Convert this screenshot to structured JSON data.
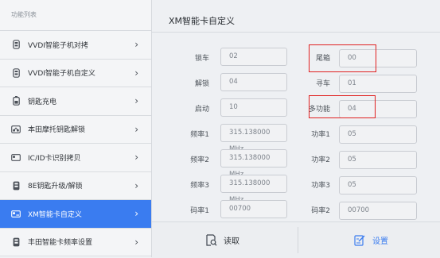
{
  "sidebar": {
    "title": "功能列表",
    "items": [
      {
        "label": "VVDI智能子机对拷",
        "icon": "remote-key-icon"
      },
      {
        "label": "VVDI智能子机自定义",
        "icon": "remote-key-icon"
      },
      {
        "label": "钥匙充电",
        "icon": "battery-key-icon"
      },
      {
        "label": "本田摩托钥匙解锁",
        "icon": "motorcycle-icon"
      },
      {
        "label": "IC/ID卡识别拷贝",
        "icon": "card-icon"
      },
      {
        "label": "8E钥匙升级/解锁",
        "icon": "key-fob-icon"
      },
      {
        "label": "XM智能卡自定义",
        "icon": "smart-card-icon",
        "active": true
      },
      {
        "label": "丰田智能卡频率设置",
        "icon": "key-fob-icon"
      }
    ]
  },
  "main": {
    "title": "XM智能卡自定义",
    "fields": {
      "lock": {
        "label": "锁车",
        "value": "02"
      },
      "unlock": {
        "label": "解锁",
        "value": "04"
      },
      "start": {
        "label": "启动",
        "value": "10"
      },
      "freq1": {
        "label": "频率1",
        "value": "315.138000   MHz"
      },
      "freq2": {
        "label": "频率2",
        "value": "315.138000   MHz"
      },
      "freq3": {
        "label": "频率3",
        "value": "315.138000   MHz"
      },
      "code1": {
        "label": "码率1",
        "value": "00700"
      },
      "trunk": {
        "label": "尾箱",
        "value": "00"
      },
      "find": {
        "label": "寻车",
        "value": "01"
      },
      "multi": {
        "label": "多功能",
        "value": "04"
      },
      "power1": {
        "label": "功率1",
        "value": "05"
      },
      "power2": {
        "label": "功率2",
        "value": "05"
      },
      "power3": {
        "label": "功率3",
        "value": "05"
      },
      "code2": {
        "label": "码率2",
        "value": "00700"
      }
    },
    "read_label": "读取",
    "set_label": "设置"
  },
  "colors": {
    "accent": "#3a7cf0",
    "highlight_box": "#e02020",
    "sidebar_bg": "#f4f5f7",
    "main_bg": "#eef0f3"
  }
}
